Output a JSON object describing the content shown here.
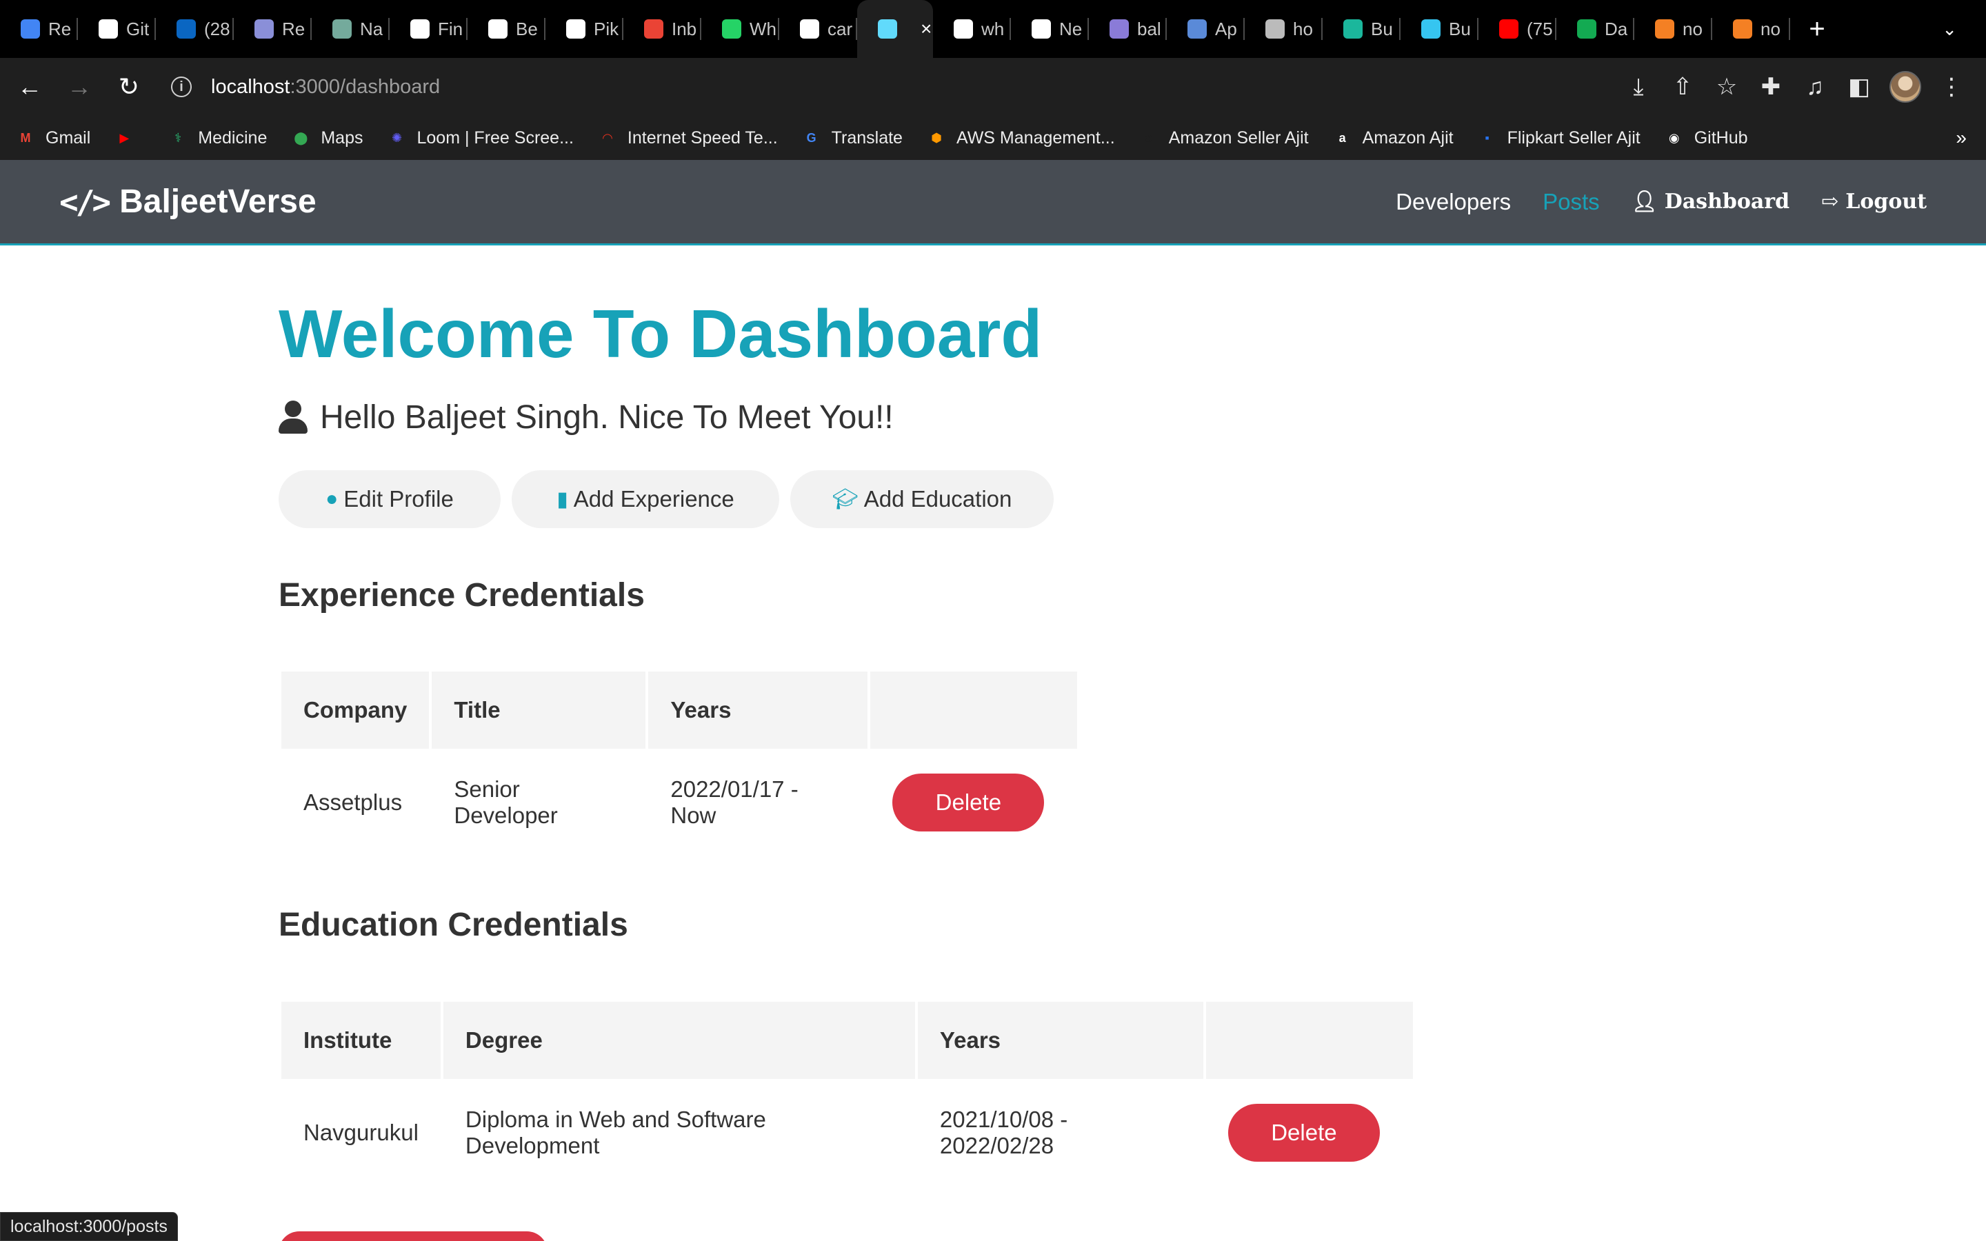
{
  "browser": {
    "tabs": [
      {
        "label": "Re",
        "icon": "docs-icon",
        "color": "#4285f4"
      },
      {
        "label": "Git",
        "icon": "github-icon",
        "color": "#ffffff"
      },
      {
        "label": "(28",
        "icon": "linkedin-icon",
        "color": "#0a66c2"
      },
      {
        "label": "Re",
        "icon": "globe-icon",
        "color": "#8a8fd8"
      },
      {
        "label": "Na",
        "icon": "chatgpt-icon",
        "color": "#74aa9c"
      },
      {
        "label": "Fin",
        "icon": "w3-icon",
        "color": "#ffffff"
      },
      {
        "label": "Be",
        "icon": "w3-icon",
        "color": "#ffffff"
      },
      {
        "label": "Pik",
        "icon": "cloud-icon",
        "color": "#ffffff"
      },
      {
        "label": "Inb",
        "icon": "gmail-icon",
        "color": "#ea4335"
      },
      {
        "label": "Wh",
        "icon": "whatsapp-icon",
        "color": "#25d366"
      },
      {
        "label": "car",
        "icon": "google-icon",
        "color": "#ffffff"
      },
      {
        "label": "",
        "icon": "react-icon",
        "color": "#61dafb",
        "active": true
      },
      {
        "label": "wh",
        "icon": "google-icon",
        "color": "#ffffff"
      },
      {
        "label": "Ne",
        "icon": "chrome-icon",
        "color": "#ffffff"
      },
      {
        "label": "bal",
        "icon": "globe-icon",
        "color": "#8a7bd8"
      },
      {
        "label": "Ap",
        "icon": "globe-icon",
        "color": "#5a8ad8"
      },
      {
        "label": "ho",
        "icon": "globe-icon",
        "color": "#bbbbbb"
      },
      {
        "label": "Bu",
        "icon": "diamond-icon",
        "color": "#1bb79c"
      },
      {
        "label": "Bu",
        "icon": "sparkle-icon",
        "color": "#36c5f0"
      },
      {
        "label": "(75",
        "icon": "youtube-icon",
        "color": "#ff0000"
      },
      {
        "label": "Da",
        "icon": "mongodb-icon",
        "color": "#13aa52"
      },
      {
        "label": "no",
        "icon": "stackoverflow-icon",
        "color": "#f48024"
      },
      {
        "label": "no",
        "icon": "stackoverflow-icon",
        "color": "#f48024"
      }
    ],
    "new_tab": "+",
    "tab_menu": "⌄",
    "url_host": "localhost",
    "url_path": ":3000/dashboard",
    "bookmarks": [
      {
        "label": "Gmail",
        "icon": "gmail-icon",
        "color": "#ea4335",
        "glyph": "M"
      },
      {
        "label": "",
        "icon": "youtube-icon",
        "color": "#ff0000",
        "glyph": "▶"
      },
      {
        "label": "Medicine",
        "icon": "medicine-icon",
        "color": "#2bb673",
        "glyph": "⚕"
      },
      {
        "label": "Maps",
        "icon": "maps-icon",
        "color": "#34a853",
        "glyph": "⬤"
      },
      {
        "label": "Loom | Free Scree...",
        "icon": "loom-icon",
        "color": "#625df5",
        "glyph": "✺"
      },
      {
        "label": "Internet Speed Te...",
        "icon": "speedometer-icon",
        "color": "#e0301e",
        "glyph": "◠"
      },
      {
        "label": "Translate",
        "icon": "translate-icon",
        "color": "#4285f4",
        "glyph": "G"
      },
      {
        "label": "AWS Management...",
        "icon": "aws-icon",
        "color": "#ff9900",
        "glyph": "⬢"
      },
      {
        "label": "Amazon Seller Ajit",
        "icon": "amazon-icon",
        "color": "#1f1f1f",
        "glyph": "a"
      },
      {
        "label": "Amazon Ajit",
        "icon": "amazon-icon",
        "color": "#ffffff",
        "glyph": "a"
      },
      {
        "label": "Flipkart Seller Ajit",
        "icon": "flipkart-icon",
        "color": "#2874f0",
        "glyph": "▪"
      },
      {
        "label": "GitHub",
        "icon": "github-icon",
        "color": "#ffffff",
        "glyph": "◉"
      }
    ],
    "bookmarks_more": "»",
    "status_url": "localhost:3000/posts"
  },
  "site": {
    "brand": "BaljeetVerse",
    "brand_icon": "code-icon",
    "nav": {
      "developers": "Developers",
      "posts": "Posts",
      "dashboard": "Dashboard",
      "logout": "Logout"
    },
    "accent_color": "#17a2b8",
    "danger_color": "#dc3545"
  },
  "dashboard": {
    "title": "Welcome To Dashboard",
    "greeting": "Hello Baljeet Singh. Nice To Meet You!!",
    "actions": {
      "edit_profile": "Edit Profile",
      "add_experience": "Add Experience",
      "add_education": "Add Education"
    },
    "experience": {
      "heading": "Experience Credentials",
      "columns": [
        "Company",
        "Title",
        "Years",
        ""
      ],
      "rows": [
        {
          "company": "Assetplus",
          "title": "Senior Developer",
          "years": "2022/01/17 - Now",
          "action": "Delete"
        }
      ]
    },
    "education": {
      "heading": "Education Credentials",
      "columns": [
        "Institute",
        "Degree",
        "Years",
        ""
      ],
      "rows": [
        {
          "institute": "Navgurukul",
          "degree": "Diploma in Web and Software Development",
          "years": "2021/10/08 - 2022/02/28",
          "action": "Delete"
        }
      ]
    }
  }
}
